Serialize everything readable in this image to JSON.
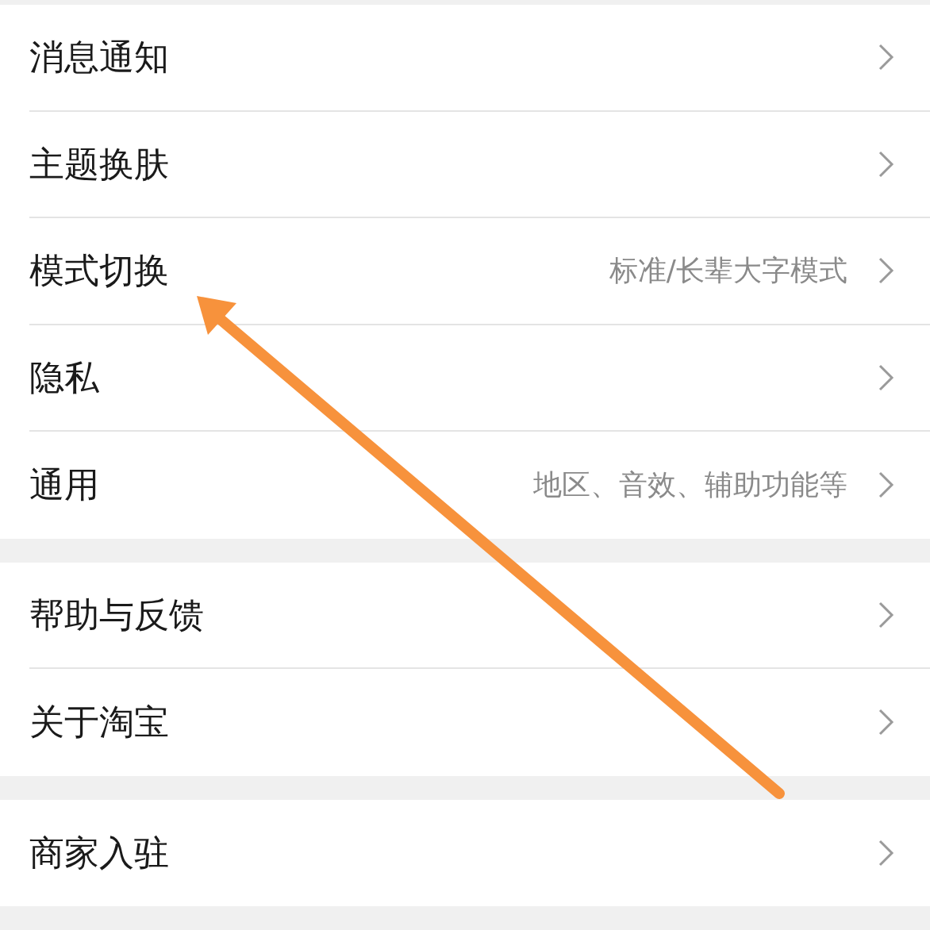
{
  "groups": [
    {
      "items": [
        {
          "label": "消息通知"
        },
        {
          "label": "主题换肤"
        },
        {
          "label": "模式切换",
          "value": "标准/长辈大字模式"
        },
        {
          "label": "隐私"
        },
        {
          "label": "通用",
          "value": "地区、音效、辅助功能等"
        }
      ]
    },
    {
      "items": [
        {
          "label": "帮助与反馈"
        },
        {
          "label": "关于淘宝"
        }
      ]
    },
    {
      "items": [
        {
          "label": "商家入驻"
        }
      ]
    }
  ]
}
